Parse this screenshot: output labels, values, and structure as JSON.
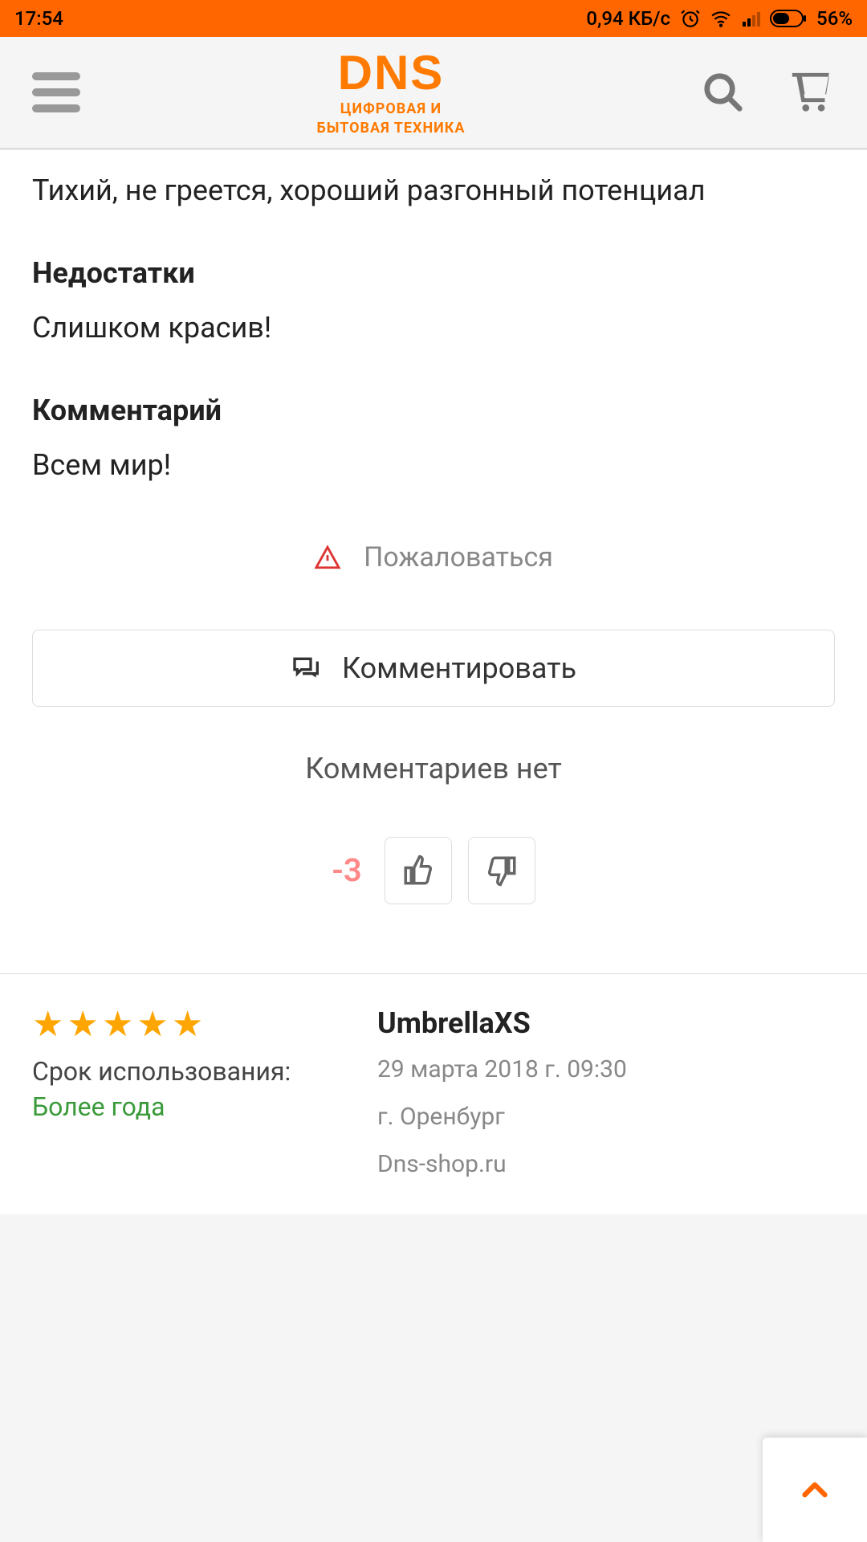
{
  "status": {
    "time": "17:54",
    "speed": "0,94 КБ/с",
    "battery": "56%"
  },
  "logo": {
    "main": "DNS",
    "sub1": "ЦИФРОВАЯ И",
    "sub2": "БЫТОВАЯ ТЕХНИКА"
  },
  "review1": {
    "advantages_text": "Тихий, не греется, хороший разгонный потенциал",
    "cons_heading": "Недостатки",
    "cons_text": "Слишком красив!",
    "comment_heading": "Комментарий",
    "comment_text": "Всем мир!",
    "report_label": "Пожаловаться",
    "comment_btn": "Комментировать",
    "no_comments": "Комментариев нет",
    "vote_score": "-3"
  },
  "review2": {
    "stars": 5,
    "usage_label": "Срок использования:",
    "usage_value": "Более года",
    "reviewer": "UmbrellaXS",
    "date": "29 марта 2018 г. 09:30",
    "city": "г. Оренбург",
    "source": "Dns-shop.ru"
  }
}
